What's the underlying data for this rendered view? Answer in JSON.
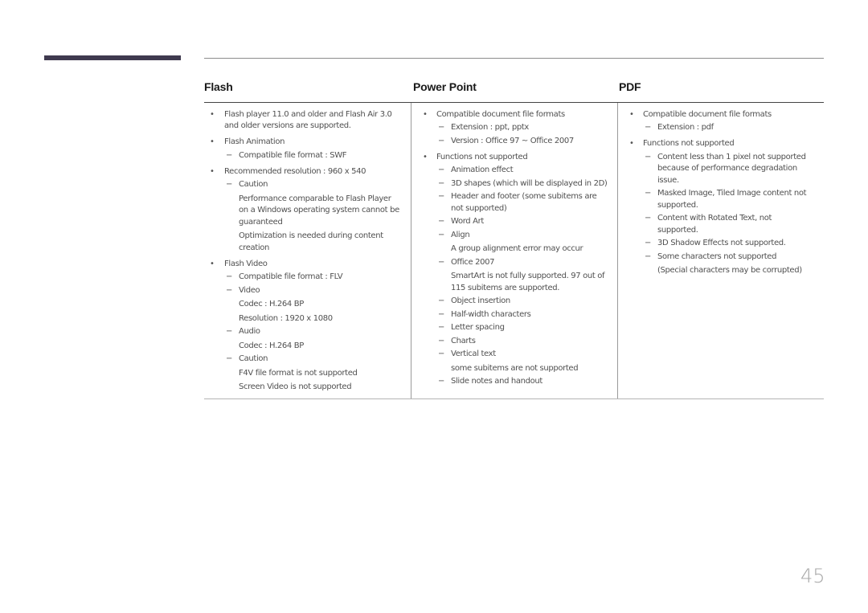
{
  "page_number": "45",
  "columns": [
    {
      "title": "Flash",
      "items": [
        {
          "text": "Flash player 11.0 and older and Flash Air 3.0 and older versions are supported.",
          "subs": []
        },
        {
          "text": "Flash Animation",
          "subs": [
            {
              "text": "Compatible file format : SWF",
              "notes": []
            }
          ]
        },
        {
          "text": "Recommended resolution : 960 x 540",
          "subs": [
            {
              "text": "Caution",
              "notes": [
                "Performance comparable to Flash Player on a Windows operating system cannot be guaranteed",
                "Optimization is needed during content creation"
              ]
            }
          ]
        },
        {
          "text": "Flash Video",
          "subs": [
            {
              "text": "Compatible file format : FLV",
              "notes": []
            },
            {
              "text": "Video",
              "notes": [
                "Codec : H.264 BP",
                "Resolution : 1920 x 1080"
              ]
            },
            {
              "text": "Audio",
              "notes": [
                "Codec : H.264 BP"
              ]
            },
            {
              "text": "Caution",
              "notes": [
                "F4V file format is not supported",
                "Screen Video is not supported"
              ]
            }
          ]
        }
      ]
    },
    {
      "title": "Power Point",
      "items": [
        {
          "text": "Compatible document file formats",
          "subs": [
            {
              "text": "Extension : ppt, pptx",
              "notes": []
            },
            {
              "text": "Version : Office 97 ~ Office 2007",
              "notes": []
            }
          ]
        },
        {
          "text": "Functions not supported",
          "subs": [
            {
              "text": "Animation effect",
              "notes": []
            },
            {
              "text": "3D shapes (which will be displayed in 2D)",
              "notes": []
            },
            {
              "text": "Header and footer (some subitems are not supported)",
              "notes": []
            },
            {
              "text": "Word Art",
              "notes": []
            },
            {
              "text": "Align",
              "notes": [
                "A group alignment error may occur"
              ]
            },
            {
              "text": "Office 2007",
              "notes": [
                "SmartArt is not fully supported. 97 out of 115 subitems are supported."
              ]
            },
            {
              "text": "Object insertion",
              "notes": []
            },
            {
              "text": "Half-width characters",
              "notes": []
            },
            {
              "text": "Letter spacing",
              "notes": []
            },
            {
              "text": "Charts",
              "notes": []
            },
            {
              "text": "Vertical text",
              "notes": [
                "some subitems are not supported"
              ]
            },
            {
              "text": "Slide notes and handout",
              "notes": []
            }
          ]
        }
      ]
    },
    {
      "title": "PDF",
      "items": [
        {
          "text": "Compatible document file formats",
          "subs": [
            {
              "text": "Extension : pdf",
              "notes": []
            }
          ]
        },
        {
          "text": "Functions not supported",
          "subs": [
            {
              "text": "Content less than 1 pixel not supported because of performance degradation issue.",
              "notes": []
            },
            {
              "text": "Masked Image, Tiled Image content not supported.",
              "notes": []
            },
            {
              "text": "Content with Rotated Text, not supported.",
              "notes": []
            },
            {
              "text": "3D Shadow Effects not supported.",
              "notes": []
            },
            {
              "text": "Some characters not supported",
              "notes": [
                "(Special characters may be corrupted)"
              ]
            }
          ]
        }
      ]
    }
  ],
  "glyphs": {
    "bullet": "•",
    "dash": "−"
  },
  "colors": {
    "chapter_bar": "#3f3a4f",
    "heading": "#1a1a1a",
    "body_text": "#505050",
    "page_number": "#a8a8a8"
  }
}
